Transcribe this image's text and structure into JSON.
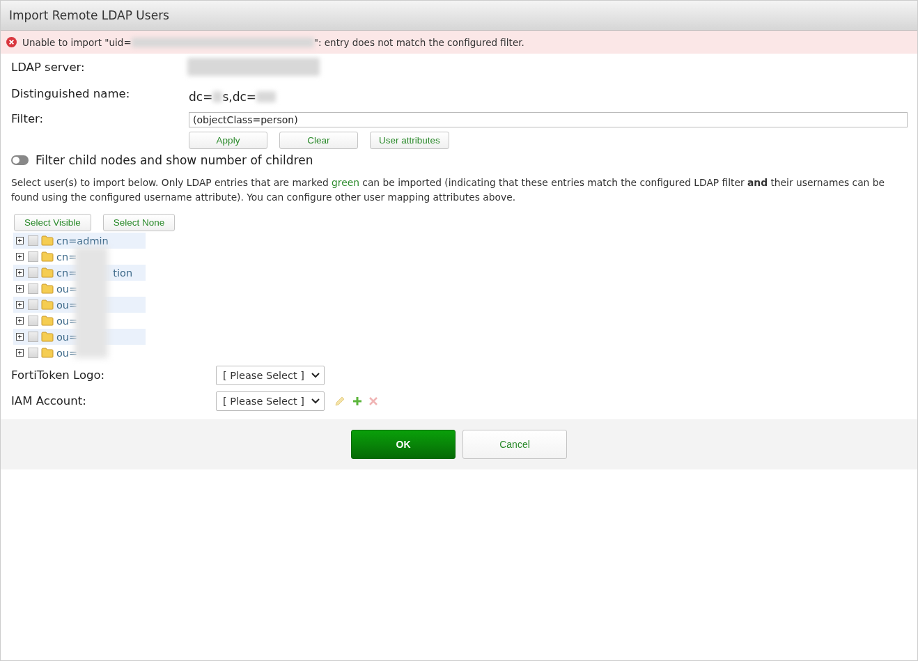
{
  "window": {
    "title": "Import Remote LDAP Users"
  },
  "error": {
    "text_before": "Unable to import \"uid=",
    "text_after": "\": entry does not match the configured filter."
  },
  "fields": {
    "ldap_server": {
      "label": "LDAP server:"
    },
    "distinguished_name": {
      "label": "Distinguished name:",
      "part_1": "dc=",
      "part_2": "s,dc="
    },
    "filter": {
      "label": "Filter:",
      "value": "(objectClass=person)"
    }
  },
  "filter_buttons": [
    "Apply",
    "Clear",
    "User attributes"
  ],
  "toggle": {
    "label": "Filter child nodes and show number of children",
    "on": false
  },
  "description": {
    "before": "Select user(s) to import below. Only LDAP entries that are marked ",
    "highlight": "green",
    "after": " can be imported (indicating that these entries match the configured LDAP filter **and** their usernames can be found using the configured username attribute). You can configure other user mapping attributes above."
  },
  "select_buttons": [
    "Select Visible",
    "Select None"
  ],
  "tree": [
    {
      "prefix": "cn=admin",
      "checked": false
    },
    {
      "prefix": "cn=",
      "checked": false
    },
    {
      "prefix": "cn=",
      "suffix": "tion",
      "checked": false
    },
    {
      "prefix": "ou=",
      "checked": false
    },
    {
      "prefix": "ou=",
      "checked": false
    },
    {
      "prefix": "ou=",
      "checked": false
    },
    {
      "prefix": "ou=",
      "checked": false
    },
    {
      "prefix": "ou=",
      "checked": false
    }
  ],
  "selects": [
    {
      "label": "FortiToken Logo:",
      "value": "[ Please Select ]",
      "actions": false
    },
    {
      "label": "IAM Account:",
      "value": "[ Please Select ]",
      "actions": true
    }
  ],
  "footer": {
    "ok": "OK",
    "cancel": "Cancel"
  }
}
